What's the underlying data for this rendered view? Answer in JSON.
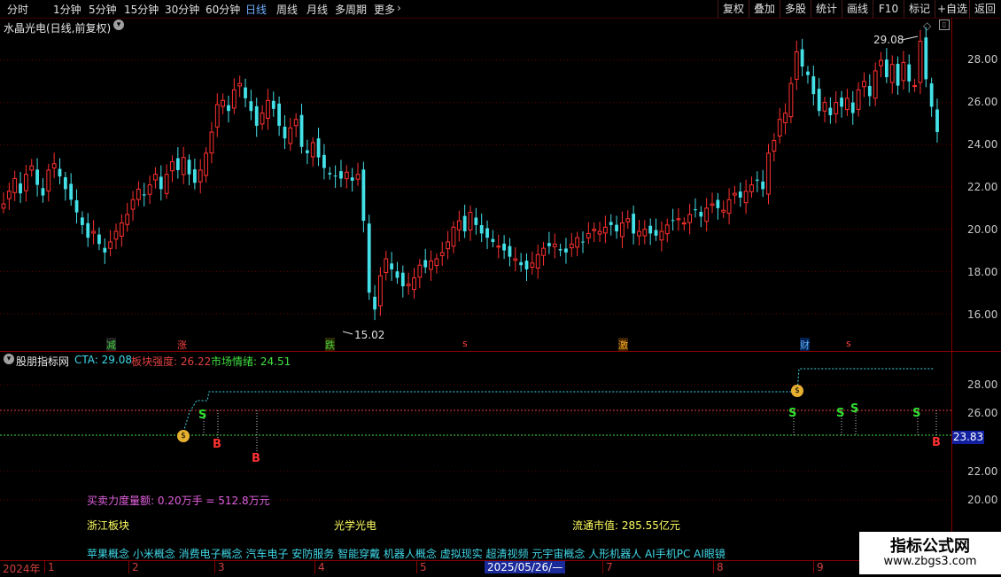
{
  "toolbar": {
    "periods": [
      "分时",
      "1分钟",
      "5分钟",
      "15分钟",
      "30分钟",
      "60分钟",
      "日线",
      "周线",
      "月线",
      "多周期",
      "更多"
    ],
    "active_period": "日线",
    "buttons": [
      "复权",
      "叠加",
      "多股",
      "统计",
      "画线",
      "F10",
      "标记",
      "+自选",
      "返回"
    ]
  },
  "main": {
    "title": "水晶光电(日线,前复权)",
    "y_ticks": [
      "28.00",
      "26.00",
      "24.00",
      "22.00",
      "20.00",
      "18.00",
      "16.00"
    ],
    "high_label": "29.08",
    "low_label": "15.02",
    "events": [
      "减",
      "涨",
      "跌",
      "s",
      "激",
      "财",
      "s"
    ]
  },
  "indicator": {
    "name": "股朋指标网",
    "cta_label": "CTA: 29.08",
    "sector_strength_label": "板块强度: 26.22",
    "market_sentiment_label": "市场情绪: 24.51",
    "y_ticks": [
      "28.00",
      "26.00",
      "22.00",
      "20.00"
    ],
    "current_value": "23.83",
    "buy_sell_text": "买卖力度量额: 0.20万手 = 512.8万元",
    "sector": "浙江板块",
    "industry": "光学光电",
    "market_cap": "流通市值: 285.55亿元",
    "concepts": "苹果概念 小米概念 消费电子概念 汽车电子 安防服务 智能穿戴 机器人概念 虚拟现实 超清视频 元宇宙概念 人形机器人 AI手机PC AI眼镜",
    "signals_s": [
      "S",
      "S",
      "S",
      "S",
      "S"
    ],
    "signals_b": [
      "B",
      "B",
      "B"
    ]
  },
  "date_axis": {
    "year": "2024年",
    "months": [
      "1",
      "2",
      "3",
      "4",
      "5",
      "7",
      "8",
      "9"
    ],
    "cursor_date": "2025/05/26/—"
  },
  "watermark": {
    "title": "指标公式网",
    "url": "www.zbgs3.com"
  },
  "colors": {
    "up": "#ff3030",
    "down": "#44e0e8",
    "axis": "#8a0000",
    "cyan_dash": "#3fd8e8",
    "red_dash": "#e04040",
    "green_dash": "#40e040"
  },
  "chart_data": {
    "type": "candlestick",
    "y_range": [
      15,
      29.5
    ],
    "closes": [
      21.2,
      21.8,
      22.4,
      21.7,
      22.6,
      23.0,
      22.1,
      21.6,
      22.8,
      23.1,
      22.5,
      21.9,
      21.4,
      20.8,
      20.2,
      19.6,
      19.9,
      19.3,
      18.9,
      19.4,
      19.9,
      20.3,
      20.7,
      21.4,
      21.9,
      21.6,
      22.1,
      22.6,
      21.9,
      22.6,
      23.2,
      22.8,
      23.4,
      22.6,
      22.2,
      22.8,
      23.6,
      24.6,
      25.9,
      26.1,
      25.6,
      26.6,
      26.9,
      26.2,
      25.6,
      24.9,
      25.5,
      26.1,
      25.7,
      24.9,
      24.3,
      24.8,
      25.2,
      23.9,
      23.6,
      24.1,
      23.4,
      22.9,
      22.6,
      22.5,
      22.4,
      22.7,
      22.3,
      22.6,
      20.4,
      17.0,
      16.2,
      17.8,
      18.6,
      18.1,
      17.7,
      17.3,
      17.4,
      17.7,
      18.3,
      18.2,
      18.5,
      18.6,
      18.9,
      19.4,
      20.1,
      20.4,
      19.9,
      20.8,
      20.2,
      19.8,
      19.6,
      19.4,
      19.2,
      19.0,
      18.7,
      18.6,
      18.3,
      18.1,
      18.4,
      18.8,
      19.1,
      19.2,
      19.3,
      19.0,
      18.9,
      19.3,
      19.6,
      19.4,
      19.8,
      20.0,
      19.9,
      20.1,
      20.2,
      19.9,
      20.3,
      20.5,
      19.8,
      19.9,
      20.0,
      19.8,
      19.7,
      19.9,
      20.2,
      20.4,
      20.5,
      20.3,
      20.7,
      20.9,
      20.6,
      21.0,
      21.2,
      21.0,
      20.9,
      21.4,
      21.7,
      21.5,
      21.8,
      22.1,
      22.3,
      21.9,
      23.6,
      24.2,
      25.2,
      25.5,
      26.9,
      28.4,
      27.7,
      27.3,
      26.4,
      25.6,
      26.0,
      25.4,
      26.0,
      25.8,
      26.2,
      25.5,
      26.6,
      27.0,
      26.3,
      27.5,
      28.0,
      27.2,
      27.8,
      26.8,
      27.9,
      27.0,
      26.8,
      28.9,
      27.1,
      25.8,
      24.6
    ]
  }
}
